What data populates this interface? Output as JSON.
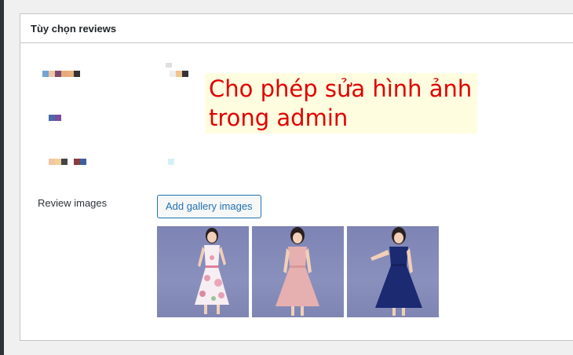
{
  "panel": {
    "title": "Tùy chọn reviews"
  },
  "fields": {
    "review_images_label": "Review images"
  },
  "gallery": {
    "add_button_label": "Add gallery images",
    "images": [
      {
        "name": "floral-dress-image",
        "dress_color": "#ffffff",
        "pattern": "floral"
      },
      {
        "name": "pink-dress-image",
        "dress_color": "#e8b4b4",
        "pattern": "plain"
      },
      {
        "name": "navy-dress-image",
        "dress_color": "#1c2a72",
        "pattern": "plain"
      }
    ]
  },
  "annotation": {
    "line1": "Cho phép sửa hình ảnh",
    "line2": "trong admin"
  },
  "colors": {
    "accent": "#2271b1",
    "annotation_text": "#e00000",
    "annotation_bg": "#fffde0"
  }
}
